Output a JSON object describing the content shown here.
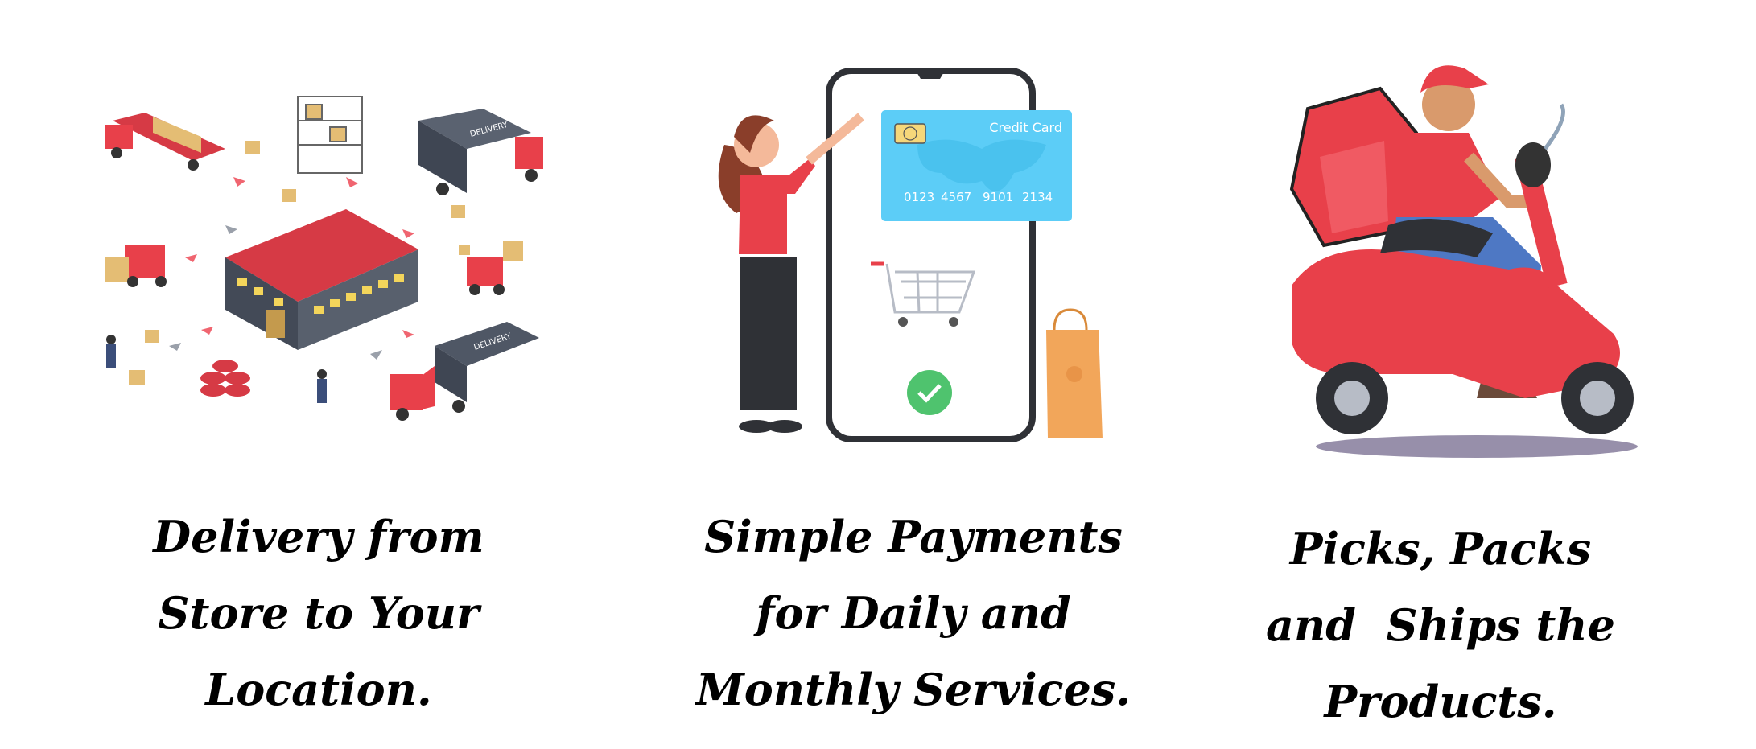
{
  "features": [
    {
      "illustration": "warehouse-logistics-illustration",
      "caption_lines": [
        "Delivery from",
        "Store to Your",
        "Location."
      ],
      "truck_label": "DELIVERY"
    },
    {
      "illustration": "phone-payment-illustration",
      "caption_lines": [
        "Simple Payments",
        "for Daily and",
        "Monthly Services."
      ],
      "card": {
        "title": "Credit Card",
        "number_groups": [
          "0123",
          "4567",
          "9101",
          "2134"
        ]
      }
    },
    {
      "illustration": "scooter-courier-illustration",
      "caption_lines": [
        "Picks, Packs",
        "and  Ships the",
        "Products."
      ]
    }
  ],
  "colors": {
    "red": "#e8404a",
    "card_blue": "#5ccdf7",
    "warehouse_gray": "#4a5260",
    "box": "#e7c27d",
    "check_green": "#4fc36e",
    "bag_orange": "#f2a65a"
  }
}
